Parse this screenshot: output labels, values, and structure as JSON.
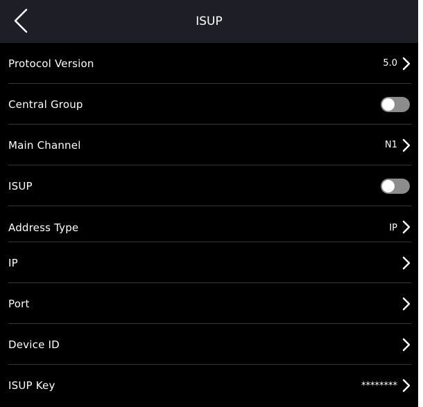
{
  "header": {
    "title": "ISUP",
    "back_icon": "chevron-left-icon"
  },
  "colors": {
    "header_bg": "#1e1f26",
    "background": "#000000",
    "divider": "#3a3a3a",
    "toggle_off": "#8c8c8c",
    "text": "#ffffff"
  },
  "rows": [
    {
      "label": "Protocol Version",
      "value": "5.0",
      "control": "chevron-right-icon"
    },
    {
      "label": "Central Group",
      "toggle": false
    },
    {
      "label": "Main Channel",
      "value": "N1",
      "control": "chevron-right-icon"
    },
    {
      "label": "ISUP",
      "toggle": false
    },
    {
      "label": "Address Type",
      "value": "IP",
      "control": "chevron-right-icon"
    },
    {
      "label": "IP",
      "value": "",
      "control": "chevron-right-icon"
    },
    {
      "label": "Port",
      "value": "",
      "control": "chevron-right-icon"
    },
    {
      "label": "Device ID",
      "value": "",
      "control": "chevron-right-icon"
    },
    {
      "label": "ISUP Key",
      "value": "********",
      "control": "chevron-right-icon"
    }
  ]
}
